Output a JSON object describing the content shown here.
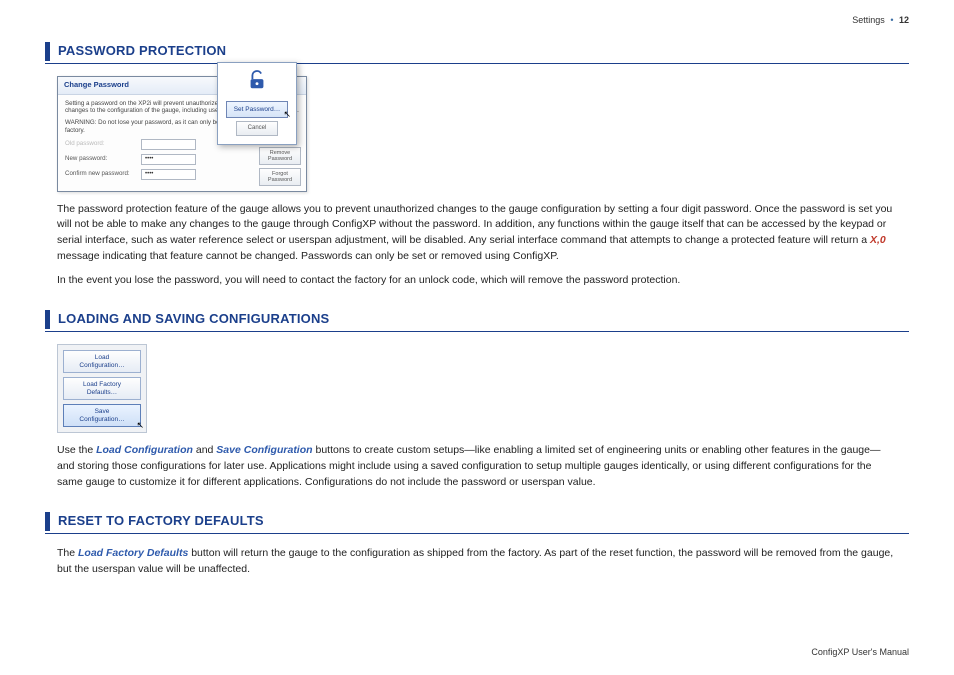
{
  "header": {
    "section_label": "Settings",
    "page_num": "12"
  },
  "sections": {
    "password": {
      "heading": "PASSWORD PROTECTION",
      "dialog": {
        "title": "Change Password",
        "intro": "Setting a password on the XP2i will prevent unauthorized users from making any changes to the configuration of the gauge, including userspans, units, and messages.",
        "warning": "WARNING: Do not lose your password, as it can only be removed by contacting the factory.",
        "old_label": "Old password:",
        "new_label": "New password:",
        "confirm_label": "Confirm new password:",
        "dots": "••••",
        "remove_btn": "Remove\nPassword",
        "forgot_btn": "Forgot\nPassword"
      },
      "popup": {
        "set_btn": "Set Password…",
        "cancel_btn": "Cancel"
      },
      "para1a": "The password protection feature of the gauge allows you to prevent unauthorized changes to the gauge configuration by setting a four digit password. Once the password is set you will not be able to make any changes to the gauge through ConfigXP without the password. In addition, any functions within the gauge itself that can be accessed by the keypad or serial interface, such as water reference select or userspan adjustment, will be disabled. Any serial interface command that attempts to change a protected feature will return a ",
      "para1_x": "X,0",
      "para1b": " message indicating that feature cannot be changed. Passwords can only be set or removed using ConfigXP.",
      "para2": "In the event you lose the password, you will need to contact the factory for an unlock code, which will remove the password protection."
    },
    "loadsave": {
      "heading": "LOADING AND SAVING CONFIGURATIONS",
      "btns": {
        "load": "Load\nConfiguration…",
        "defaults": "Load Factory\nDefaults…",
        "save": "Save\nConfiguration…"
      },
      "para_a": "Use the ",
      "para_load": "Load Configuration",
      "para_b": " and ",
      "para_save": "Save Configuration",
      "para_c": " buttons to create custom setups—like enabling a limited set of engineering units or enabling other features in the gauge—and storing those configurations for later use. Applications might include using a saved configuration to setup multiple gauges identically, or using different configurations for the same gauge to customize it for different applications. Configurations do not include the password or userspan value."
    },
    "reset": {
      "heading": "RESET TO FACTORY DEFAULTS",
      "para_a": "The ",
      "para_term": "Load Factory Defaults",
      "para_b": " button will return the gauge to the configuration as shipped from the factory. As part of the reset function, the password will be removed from the gauge, but the userspan value will be unaffected."
    }
  },
  "footer": {
    "text": "ConfigXP User's Manual"
  }
}
